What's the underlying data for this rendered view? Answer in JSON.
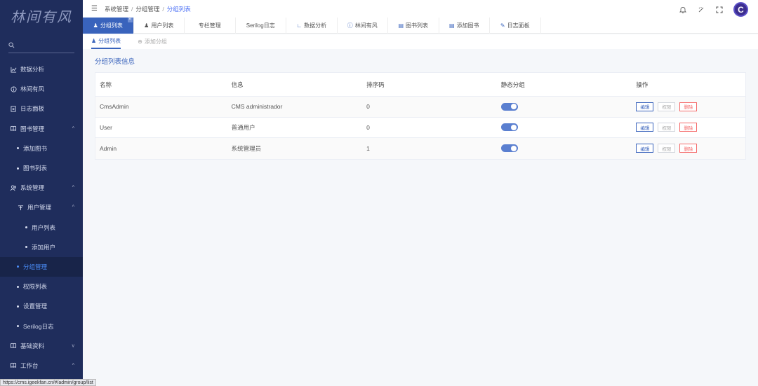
{
  "logo": "林间有风",
  "sidebar": {
    "items": [
      {
        "label": "数据分析",
        "icon": "chart-icon"
      },
      {
        "label": "林间有风",
        "icon": "info-icon"
      },
      {
        "label": "日志面板",
        "icon": "log-icon"
      },
      {
        "label": "图书管理",
        "icon": "book-icon",
        "arrow": "^"
      },
      {
        "label": "添加图书"
      },
      {
        "label": "图书列表"
      },
      {
        "label": "系统管理",
        "icon": "users-icon",
        "arrow": "^"
      },
      {
        "label": "用户管理",
        "icon": "user-icon",
        "arrow": "^"
      },
      {
        "label": "用户列表"
      },
      {
        "label": "添加用户"
      },
      {
        "label": "分组管理"
      },
      {
        "label": "权限列表"
      },
      {
        "label": "设置管理"
      },
      {
        "label": "Serilog日志"
      },
      {
        "label": "基础资料",
        "icon": "book-icon",
        "arrow": "v"
      },
      {
        "label": "工作台",
        "icon": "book-icon",
        "arrow": "^"
      }
    ]
  },
  "breadcrumb": [
    "系统管理",
    "分组管理",
    "分组列表"
  ],
  "tabs": [
    {
      "label": "分组列表",
      "icon": "users-icon"
    },
    {
      "label": "用户列表",
      "icon": "users-icon"
    },
    {
      "label": "专栏管理",
      "icon": ""
    },
    {
      "label": "Serilog日志",
      "icon": ""
    },
    {
      "label": "数据分析",
      "icon": "chart-icon"
    },
    {
      "label": "林间有风",
      "icon": "info-icon"
    },
    {
      "label": "图书列表",
      "icon": "book-icon"
    },
    {
      "label": "添加图书",
      "icon": "book-icon"
    },
    {
      "label": "日志面板",
      "icon": "log-icon"
    }
  ],
  "subtabs": [
    {
      "label": "分组列表"
    },
    {
      "label": "添加分组"
    }
  ],
  "section_title": "分组列表信息",
  "table": {
    "headers": [
      "名称",
      "信息",
      "排序码",
      "静态分组",
      "操作"
    ],
    "rows": [
      {
        "name": "CmsAdmin",
        "info": "CMS administrador",
        "sort": "0",
        "static": true
      },
      {
        "name": "User",
        "info": "普通用户",
        "sort": "0",
        "static": true
      },
      {
        "name": "Admin",
        "info": "系统管理员",
        "sort": "1",
        "static": true
      }
    ],
    "actions": {
      "edit": "编辑",
      "perm": "权限",
      "delete": "删除"
    }
  },
  "avatar_letter": "C",
  "status_url": "https://cms.igeekfan.cn/#/admin/group/list",
  "colors": {
    "sidebar": "#1f2d5c",
    "accent": "#3963bc",
    "danger": "#f56c6c"
  }
}
